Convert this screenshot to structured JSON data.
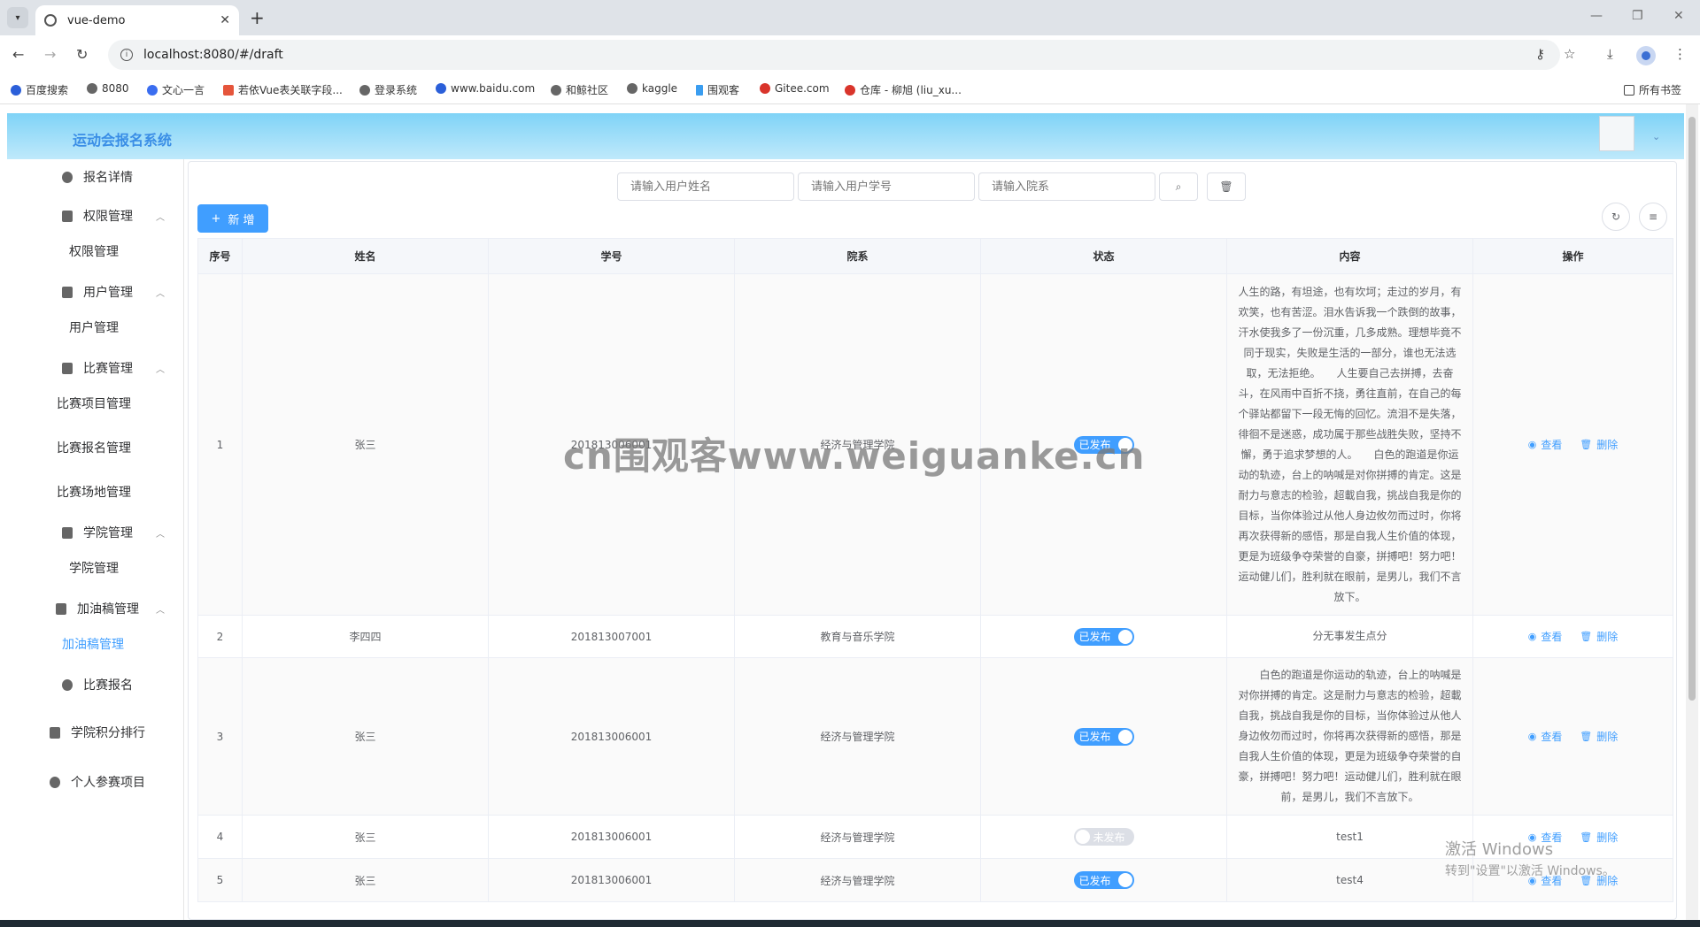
{
  "browser": {
    "tab_title": "vue-demo",
    "url": "localhost:8080/#/draft",
    "bookmarks": [
      "百度搜索",
      "8080",
      "文心一言",
      "若依Vue表关联字段...",
      "登录系统",
      "www.baidu.com",
      "和鲸社区",
      "kaggle",
      "围观客",
      "Gitee.com",
      "仓库 - 柳旭 (liu_xu..."
    ],
    "all_bookmarks": "所有书签"
  },
  "app": {
    "title": "运动会报名系统"
  },
  "sidebar": {
    "items": [
      {
        "label": "报名详情"
      },
      {
        "label": "权限管理",
        "sub": "权限管理"
      },
      {
        "label": "用户管理",
        "sub": "用户管理"
      },
      {
        "label": "比赛管理",
        "subs": [
          "比赛项目管理",
          "比赛报名管理",
          "比赛场地管理"
        ]
      },
      {
        "label": "学院管理",
        "sub": "学院管理"
      },
      {
        "label": "加油稿管理",
        "sub": "加油稿管理"
      },
      {
        "label": "比赛报名"
      },
      {
        "label": "学院积分排行"
      },
      {
        "label": "个人参赛项目"
      }
    ]
  },
  "toolbar": {
    "name_placeholder": "请输入用户姓名",
    "id_placeholder": "请输入用户学号",
    "dept_placeholder": "请输入院系",
    "add_label": "新 增"
  },
  "table": {
    "headers": [
      "序号",
      "姓名",
      "学号",
      "院系",
      "状态",
      "内容",
      "操作"
    ],
    "view_label": "查看",
    "delete_label": "删除",
    "rows": [
      {
        "index": "1",
        "name": "张三",
        "sid": "201813006001",
        "dept": "经济与管理学院",
        "status": "已发布",
        "published": true,
        "content": "人生的路，有坦途，也有坎坷；走过的岁月，有欢笑，也有苦涩。泪水告诉我一个跌倒的故事，汗水使我多了一份沉重，几多成熟。理想毕竟不同于现实，失败是生活的一部分，谁也无法选取，无法拒绝。　　人生要自己去拼搏，去奋斗，在风雨中百折不挠，勇往直前，在自己的每个驿站都留下一段无悔的回忆。流泪不是失落，徘徊不是迷惑，成功属于那些战胜失败，坚持不懈，勇于追求梦想的人。　　白色的跑道是你运动的轨迹，台上的呐喊是对你拼搏的肯定。这是耐力与意志的检验，超載自我，挑战自我是你的目标，当你体验过从他人身边攸勿而过时，你将再次获得新的感悟，那是自我人生价值的体现，更是为班级争夺荣誉的自豪，拼搏吧！努力吧！运动健儿们，胜利就在眼前，是男儿，我们不言放下。"
      },
      {
        "index": "2",
        "name": "李四四",
        "sid": "201813007001",
        "dept": "教育与音乐学院",
        "status": "已发布",
        "published": true,
        "content": "分无事发生点分"
      },
      {
        "index": "3",
        "name": "张三",
        "sid": "201813006001",
        "dept": "经济与管理学院",
        "status": "已发布",
        "published": true,
        "content": "　　白色的跑道是你运动的轨迹，台上的呐喊是对你拼搏的肯定。这是耐力与意志的检验，超載自我，挑战自我是你的目标，当你体验过从他人身边攸勿而过时，你将再次获得新的感悟，那是自我人生价值的体现，更是为班级争夺荣誉的自豪，拼搏吧！努力吧！运动健儿们，胜利就在眼前，是男儿，我们不言放下。"
      },
      {
        "index": "4",
        "name": "张三",
        "sid": "201813006001",
        "dept": "经济与管理学院",
        "status": "未发布",
        "published": false,
        "content": "test1"
      },
      {
        "index": "5",
        "name": "张三",
        "sid": "201813006001",
        "dept": "经济与管理学院",
        "status": "已发布",
        "published": true,
        "content": "test4"
      }
    ]
  },
  "overlays": {
    "watermark": "cn围观客www.weiguanke.cn",
    "win_activate_1": "激活 Windows",
    "win_activate_2": "转到\"设置\"以激活 Windows。"
  }
}
